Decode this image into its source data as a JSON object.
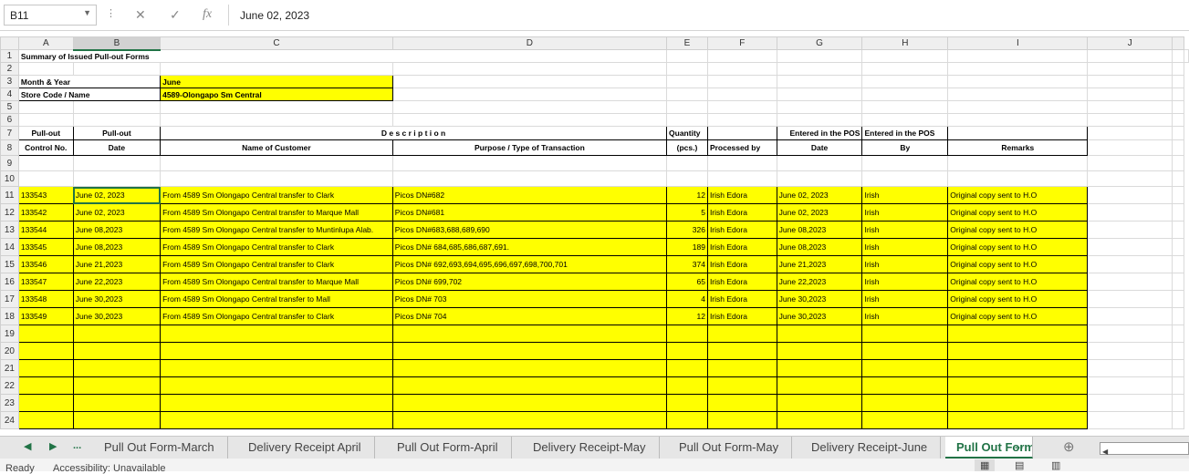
{
  "formula_bar": {
    "name_box": "B11",
    "value": "June 02, 2023"
  },
  "columns": [
    "A",
    "B",
    "C",
    "D",
    "E",
    "F",
    "G",
    "H",
    "I",
    "J"
  ],
  "title": "Summary of Issued Pull-out Forms",
  "info": {
    "month_label": "Month & Year",
    "month_value": "June",
    "store_label": "Store Code / Name",
    "store_value": "4589-Olongapo Sm Central"
  },
  "headers": {
    "pullout1": "Pull-out",
    "control": "Control No.",
    "pullout2": "Pull-out",
    "date": "Date",
    "description": "D e s c r i p t i o n",
    "customer": "Name of Customer",
    "purpose": "Purpose / Type of Transaction",
    "quantity": "Quantity",
    "pcs": "(pcs.)",
    "processed": "Processed by",
    "pos1": "Entered in the POS",
    "pos_date": "Date",
    "pos2": "Entered in the POS",
    "pos_by": "By",
    "remarks": "Remarks"
  },
  "rows": [
    [
      "133543",
      "June 02, 2023",
      "From 4589 Sm Olongapo Central transfer to  Clark",
      "Picos DN#682",
      "12",
      "Irish Edora",
      "June 02, 2023",
      "Irish",
      "Original copy sent to H.O"
    ],
    [
      "133542",
      "June 02, 2023",
      "From 4589 Sm Olongapo Central transfer to Marque Mall",
      "Picos DN#681",
      "5",
      "Irish Edora",
      "June 02, 2023",
      "Irish",
      "Original copy sent to H.O"
    ],
    [
      "133544",
      "June 08,2023",
      "From 4589 Sm Olongapo Central transfer to Muntinlupa Alab.",
      "Picos DN#683,688,689,690",
      "326",
      "Irish Edora",
      "June 08,2023",
      "Irish",
      "Original copy sent to H.O"
    ],
    [
      "133545",
      "June 08,2023",
      "From 4589 Sm Olongapo Central transfer to  Clark",
      "Picos DN# 684,685,686,687,691.",
      "189",
      "Irish Edora",
      "June 08,2023",
      "Irish",
      "Original copy sent to H.O"
    ],
    [
      "133546",
      "June 21,2023",
      "From 4589 Sm Olongapo Central transfer to Clark",
      "Picos DN# 692,693,694,695,696,697,698,700,701",
      "374",
      "Irish Edora",
      "June 21,2023",
      "Irish",
      "Original copy sent to H.O"
    ],
    [
      "133547",
      "June 22,2023",
      "From 4589 Sm Olongapo Central transfer to Marque Mall",
      "Picos DN# 699,702",
      "65",
      "Irish Edora",
      "June 22,2023",
      "Irish",
      "Original copy sent to H.O"
    ],
    [
      "133548",
      "June 30,2023",
      "From 4589 Sm Olongapo Central transfer to Mall",
      "Picos DN# 703",
      "4",
      "Irish Edora",
      "June 30,2023",
      "Irish",
      "Original copy sent to H.O"
    ],
    [
      "133549",
      "June 30,2023",
      "From 4589 Sm Olongapo Central transfer to  Clark",
      "Picos DN# 704",
      "12",
      "Irish Edora",
      "June 30,2023",
      "Irish",
      "Original copy sent to H.O"
    ]
  ],
  "sheet_tabs": [
    "Pull Out Form-March",
    "Delivery Receipt April",
    "Pull Out Form-April",
    "Delivery Receipt-May",
    "Pull Out Form-May",
    "Delivery Receipt-June",
    "Pull Out Form"
  ],
  "tab_more": "...",
  "status": {
    "ready": "Ready",
    "accessibility": "Accessibility: Unavailable"
  }
}
